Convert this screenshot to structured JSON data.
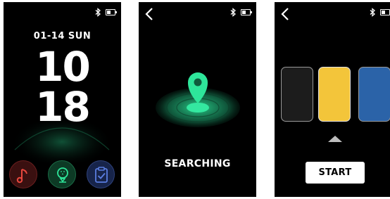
{
  "colors": {
    "screen_bg": "#000000",
    "accent_green": "#2ee59a",
    "card_black": "#1c1c1c",
    "card_yellow": "#f3c53a",
    "card_blue": "#2b63a8"
  },
  "screens": [
    {
      "name": "home",
      "status": {
        "bluetooth_icon": "bluetooth-icon",
        "battery_icon": "battery-icon",
        "battery_level": 0.4
      },
      "date": "01-14 SUN",
      "hour": "10",
      "minute": "18",
      "apps": [
        {
          "icon": "music-note-icon",
          "color": "#e8473d"
        },
        {
          "icon": "golf-ball-icon",
          "color": "#2ee59a"
        },
        {
          "icon": "clipboard-check-icon",
          "color": "#5a7de0"
        }
      ]
    },
    {
      "name": "searching",
      "back_icon": "chevron-left-icon",
      "status": {
        "bluetooth_icon": "bluetooth-icon",
        "battery_icon": "battery-icon",
        "battery_level": 0.4
      },
      "illustration": "location-pin-radar-icon",
      "label": "SEARCHING"
    },
    {
      "name": "select-card",
      "back_icon": "chevron-left-icon",
      "status": {
        "bluetooth_icon": "bluetooth-icon",
        "battery_icon": "battery-icon",
        "battery_level": 0.4
      },
      "cards": [
        {
          "color_name": "black",
          "color": "#1c1c1c",
          "selected": false
        },
        {
          "color_name": "yellow",
          "color": "#f3c53a",
          "selected": true
        },
        {
          "color_name": "blue",
          "color": "#2b63a8",
          "selected": false
        }
      ],
      "selection_indicator": "caret-up-icon",
      "start_label": "START"
    }
  ]
}
